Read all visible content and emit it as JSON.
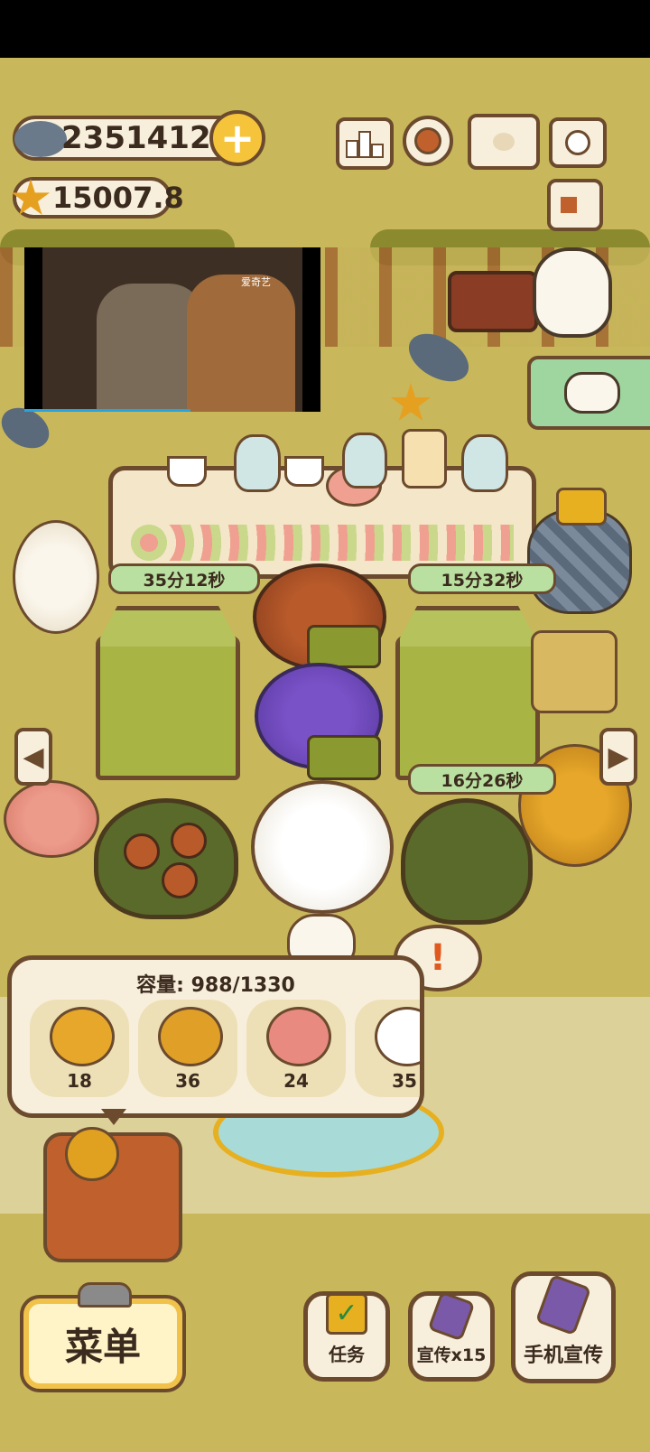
{
  "currency": {
    "fish_amount": "23514124",
    "add_label": "+",
    "star_amount": "15007.8"
  },
  "top_icons": [
    "ranking-icon",
    "settings-gear-icon",
    "catbook-icon",
    "camera-icon",
    "newspaper-icon"
  ],
  "video": {
    "watermark": "爱奇艺",
    "progress_fraction": 0.56
  },
  "timers": {
    "left_greenhouse": "35分12秒",
    "right_greenhouse_top": "15分32秒",
    "right_greenhouse_bottom": "16分26秒"
  },
  "storage": {
    "capacity_label": "容量: 988/1330",
    "items": [
      {
        "icon": "sunflower-icon",
        "count": "18",
        "color": "#e6a72a"
      },
      {
        "icon": "sunflower-bunch-icon",
        "count": "36",
        "color": "#e0a028"
      },
      {
        "icon": "pink-flower-icon",
        "count": "24",
        "color": "#e98a80"
      },
      {
        "icon": "white-lily-icon",
        "count": "35",
        "color": "#ffffff"
      }
    ]
  },
  "alert": {
    "symbol": "!"
  },
  "bottom_bar": {
    "menu_label": "菜单",
    "tasks_label": "任务",
    "promote_label": "宣传x15",
    "phone_promote_label": "手机宣传"
  },
  "colors": {
    "ground": "#c8b75b",
    "outline": "#6b4a2e",
    "timer_bg": "#b9e0a0",
    "menu_border": "#f0c24a"
  }
}
